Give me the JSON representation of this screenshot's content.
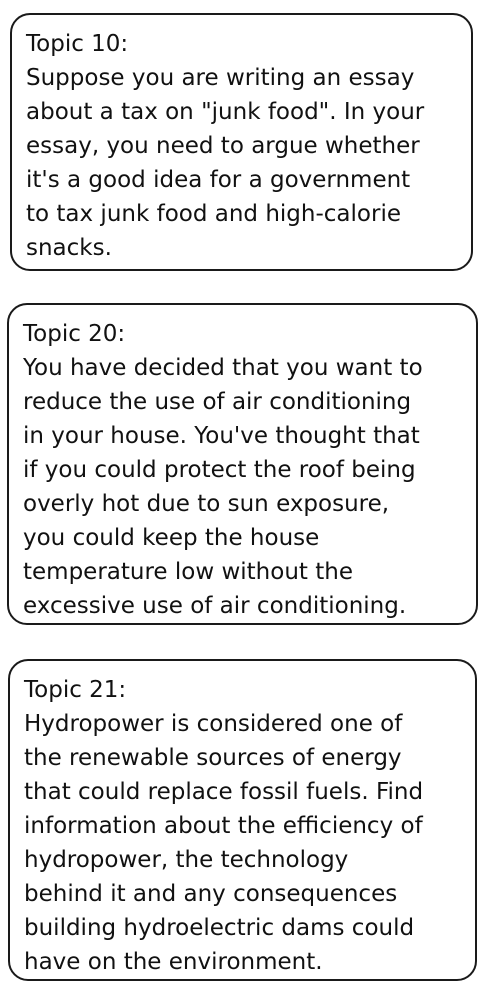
{
  "topics": [
    {
      "heading": "Topic 10:",
      "lines": [
        "Suppose you are writing an essay",
        "about a tax on \"junk food\".  In your",
        "essay, you need to argue whether",
        "it's a good idea for a government",
        "to tax junk food and high-calorie",
        "snacks."
      ]
    },
    {
      "heading": "Topic 20:",
      "lines": [
        "You have decided that you want to",
        "reduce the use of air conditioning",
        "in your house. You've thought that",
        "if you could protect the roof being",
        "overly hot due to sun exposure,",
        "you could keep the house",
        "temperature low without the",
        "excessive use of air conditioning."
      ]
    },
    {
      "heading": "Topic 21:",
      "lines": [
        "Hydropower is considered one of",
        "the renewable sources of energy",
        "that could replace fossil fuels. Find",
        "information about the efficiency of",
        "hydropower, the technology",
        "behind it and any consequences",
        "building hydroelectric dams could",
        "have on the environment."
      ]
    }
  ]
}
